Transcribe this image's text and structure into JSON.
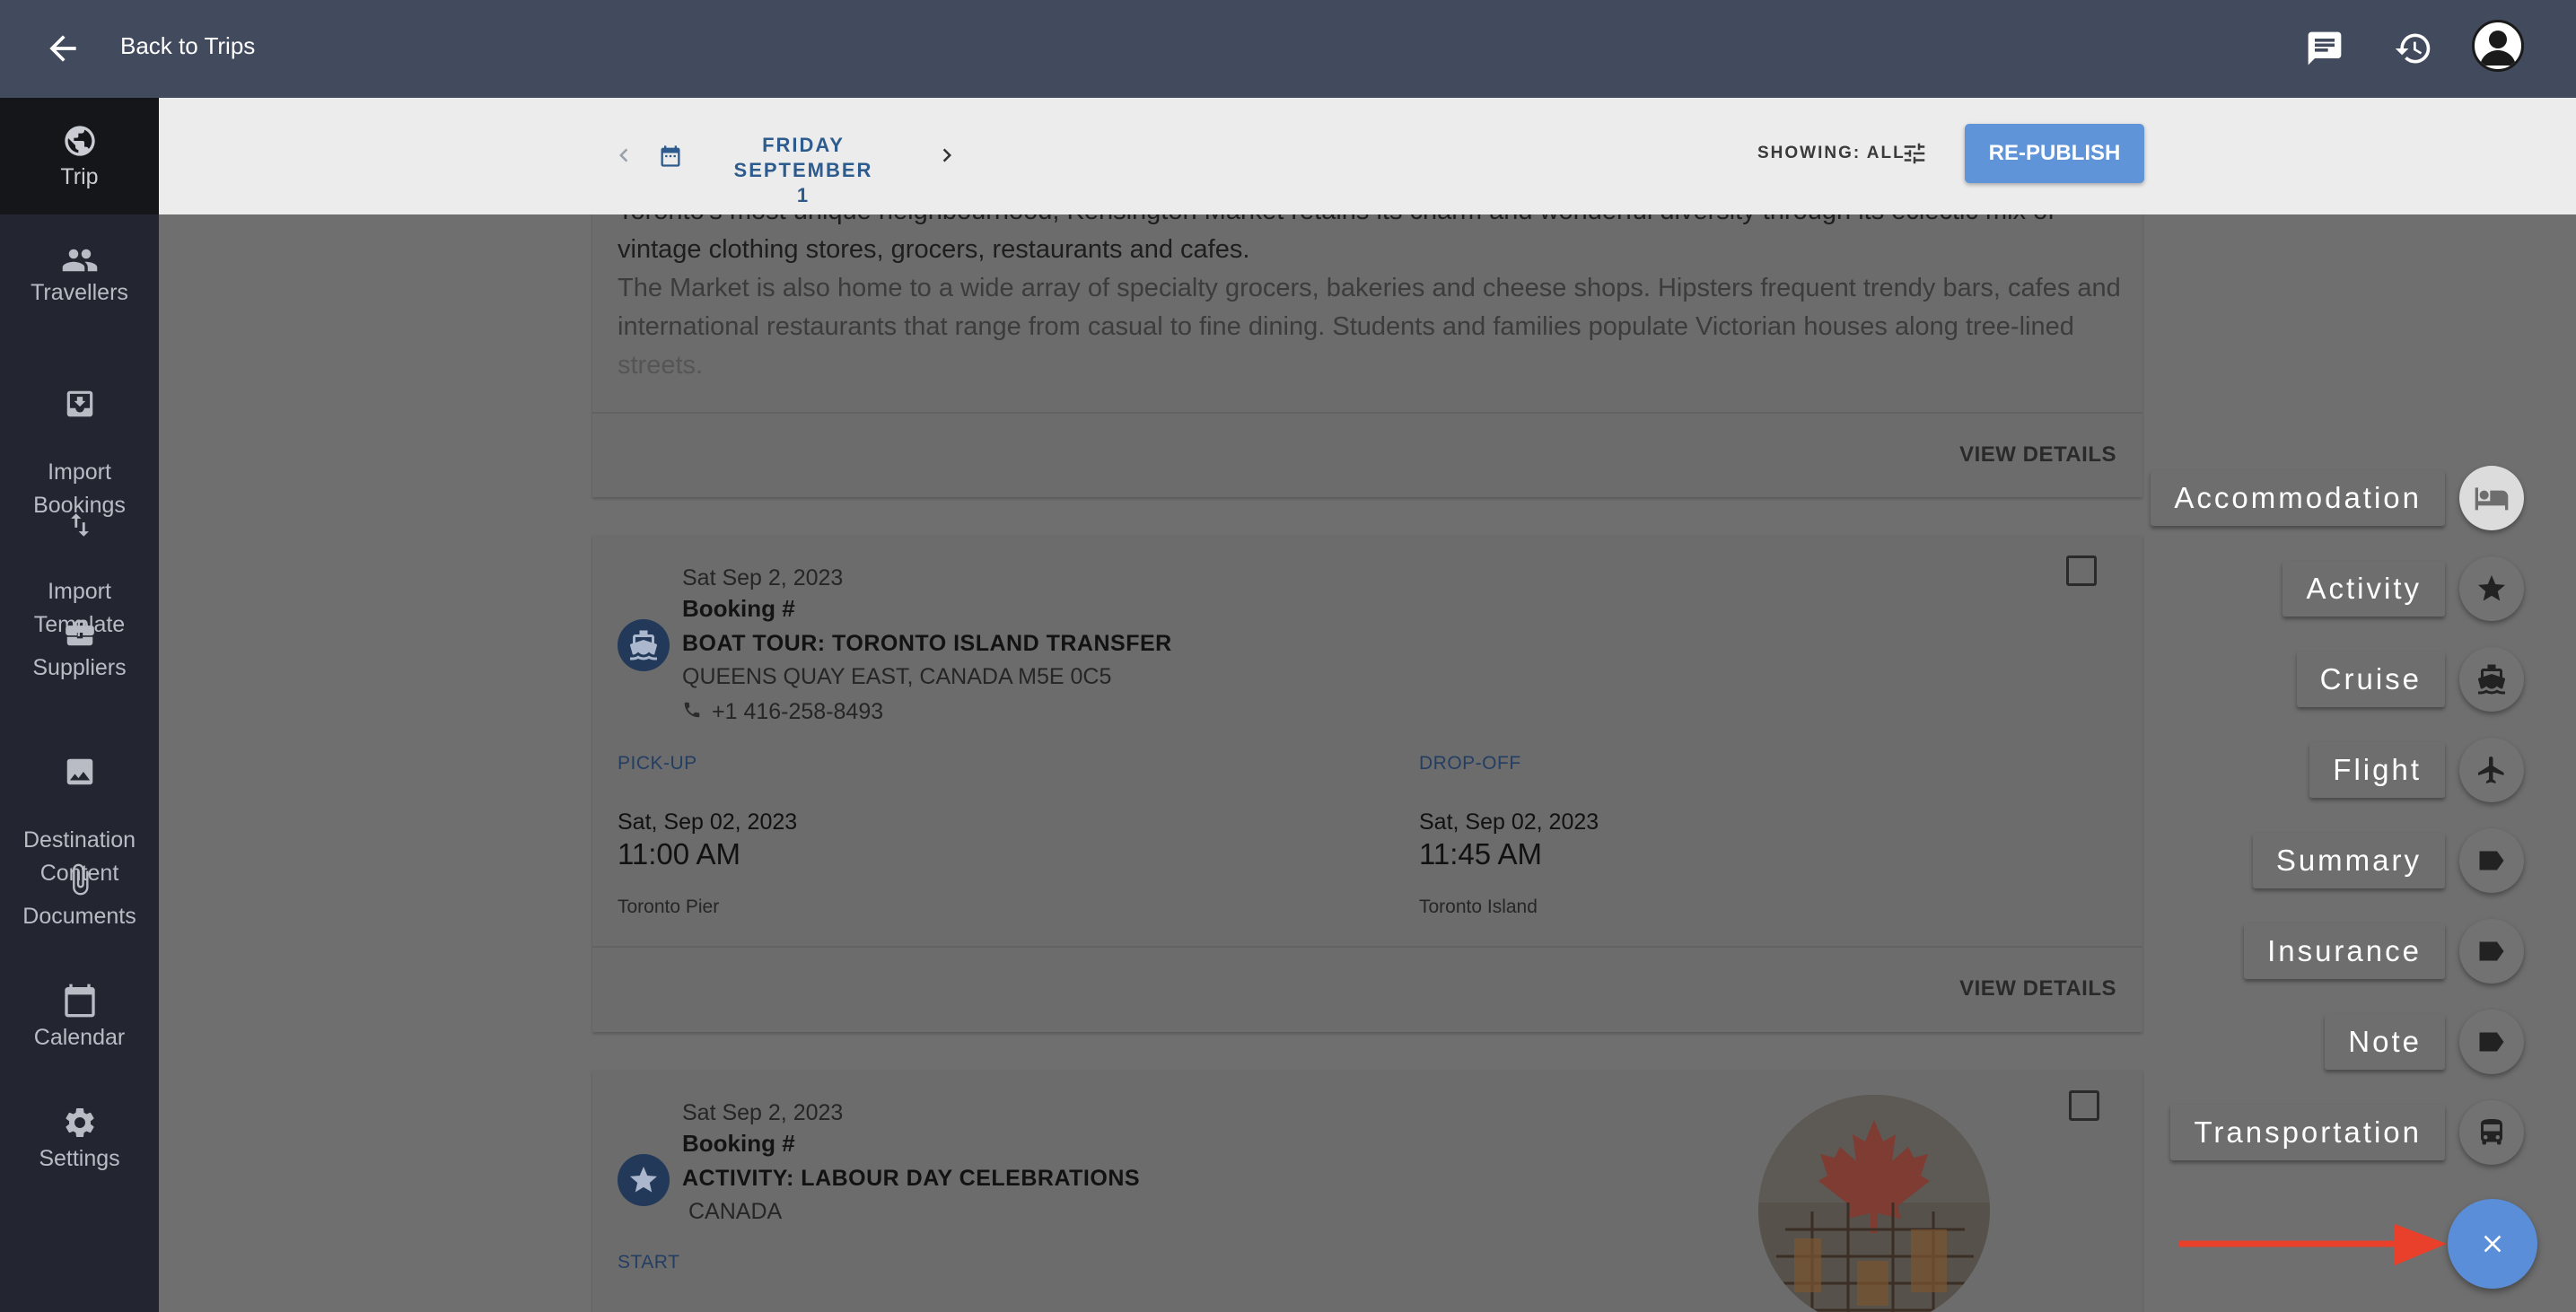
{
  "topbar": {
    "back_label": "Back to Trips",
    "icons": [
      "chat-icon",
      "history-icon",
      "account-icon"
    ]
  },
  "sidebar": {
    "items": [
      {
        "label": "Trip",
        "icon": "globe-icon",
        "active": true
      },
      {
        "label": "Travellers",
        "icon": "people-icon"
      },
      {
        "label": "Import\nBookings",
        "icon": "import-icon"
      },
      {
        "label": "Import\nTemplate",
        "icon": "swap-vert-icon"
      },
      {
        "label": "Suppliers",
        "icon": "briefcase-icon"
      },
      {
        "label": "Destination\nContent",
        "icon": "image-icon"
      },
      {
        "label": "Documents",
        "icon": "attachment-icon"
      },
      {
        "label": "Calendar",
        "icon": "calendar-icon"
      },
      {
        "label": "Settings",
        "icon": "gear-icon"
      }
    ]
  },
  "date_header": {
    "date_line1": "FRIDAY SEPTEMBER",
    "date_line2": "1",
    "showing": "SHOWING: ALL",
    "republish": "RE-PUBLISH"
  },
  "card1": {
    "line1": "Toronto's most unique neighbourhood, Kensington Market retains its charm and wonderful diversity through its eclectic mix of",
    "line2": "vintage clothing stores, grocers, restaurants and cafes.",
    "line3": "The Market is also home to a wide array of specialty grocers, bakeries and cheese shops. Hipsters frequent trendy bars, cafes and",
    "line4": "international restaurants that range from casual to fine dining. Students and families populate Victorian houses along tree-lined",
    "line5": "streets.",
    "view_details": "VIEW DETAILS"
  },
  "card2": {
    "date": "Sat Sep 2, 2023",
    "booking": "Booking #",
    "title": "BOAT TOUR: TORONTO ISLAND TRANSFER",
    "address": "QUEENS QUAY EAST, CANADA M5E 0C5",
    "phone": "+1 416-258-8493",
    "pickup_label": "PICK-UP",
    "pickup_date": "Sat, Sep 02, 2023",
    "pickup_time": "11:00 AM",
    "pickup_place": "Toronto Pier",
    "dropoff_label": "DROP-OFF",
    "dropoff_date": "Sat, Sep 02, 2023",
    "dropoff_time": "11:45 AM",
    "dropoff_place": "Toronto Island",
    "view_details": "VIEW DETAILS"
  },
  "card3": {
    "date": "Sat Sep 2, 2023",
    "booking": "Booking #",
    "title": "ACTIVITY: LABOUR DAY CELEBRATIONS",
    "address": "CANADA",
    "start_label": "START"
  },
  "fab_menu": {
    "items": [
      {
        "label": "Accommodation",
        "icon": "bed-icon"
      },
      {
        "label": "Activity",
        "icon": "star-icon"
      },
      {
        "label": "Cruise",
        "icon": "ship-icon"
      },
      {
        "label": "Flight",
        "icon": "airplane-icon"
      },
      {
        "label": "Summary",
        "icon": "label-icon"
      },
      {
        "label": "Insurance",
        "icon": "label-icon"
      },
      {
        "label": "Note",
        "icon": "label-icon"
      },
      {
        "label": "Transportation",
        "icon": "bus-icon"
      }
    ],
    "close": "×"
  },
  "colors": {
    "topbar": "#424a5d",
    "sidebar": "#232630",
    "accent": "#5f94d8",
    "annotation_arrow": "#e8402b"
  }
}
